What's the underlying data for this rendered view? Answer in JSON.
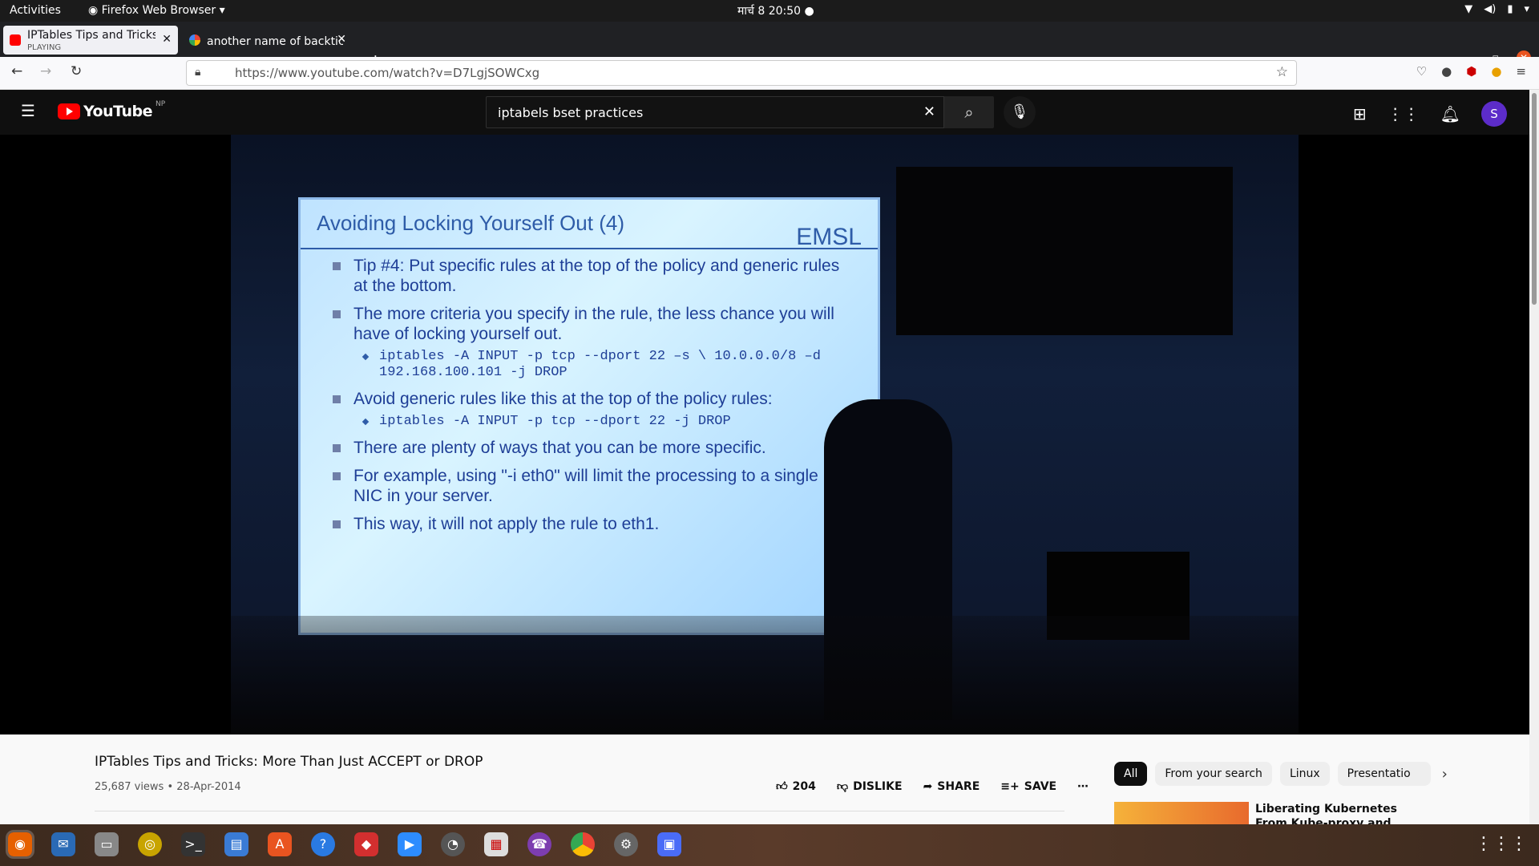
{
  "system": {
    "activities": "Activities",
    "app_name": "Firefox Web Browser",
    "clock": "मार्च 8  20:50"
  },
  "browser": {
    "tabs": [
      {
        "title": "IPTables Tips and Tricks: M",
        "subtitle": "PLAYING"
      },
      {
        "title": "another name of backtick"
      }
    ],
    "new_tab": "+",
    "url": "https://www.youtube.com/watch?v=D7LgjSOWCxg"
  },
  "youtube": {
    "logo_text": "YouTube",
    "country": "NP",
    "search_value": "iptabels bset practices",
    "avatar_letter": "S"
  },
  "video_frame": {
    "slide_title": "Avoiding Locking Yourself Out (4)",
    "slide_logo": "EMSL",
    "bullets": [
      "Tip #4: Put specific rules at the top of the policy and generic rules at the bottom.",
      "The more criteria you specify in the rule, the less chance you will have of locking yourself out.",
      "iptables -A INPUT -p tcp --dport 22 –s \\ 10.0.0.0/8 –d 192.168.100.101 -j DROP",
      "Avoid generic rules like this at the top of the policy rules:",
      "iptables -A INPUT -p tcp --dport 22 -j DROP",
      "There are plenty of ways that you can be more specific.",
      "For example, using \"-i eth0\" will limit the processing to a single NIC in your server.",
      "This way, it will not apply the rule to eth1."
    ]
  },
  "video": {
    "title": "IPTables Tips and Tricks: More Than Just ACCEPT or DROP",
    "views": "25,687 views",
    "date": "28-Apr-2014",
    "likes": "204",
    "dislike_label": "DISLIKE",
    "share_label": "SHARE",
    "save_label": "SAVE"
  },
  "chips": [
    "All",
    "From your search",
    "Linux",
    "Presentatio"
  ],
  "recommended": {
    "title": "Liberating Kubernetes From Kube-proxy and Iptables"
  }
}
